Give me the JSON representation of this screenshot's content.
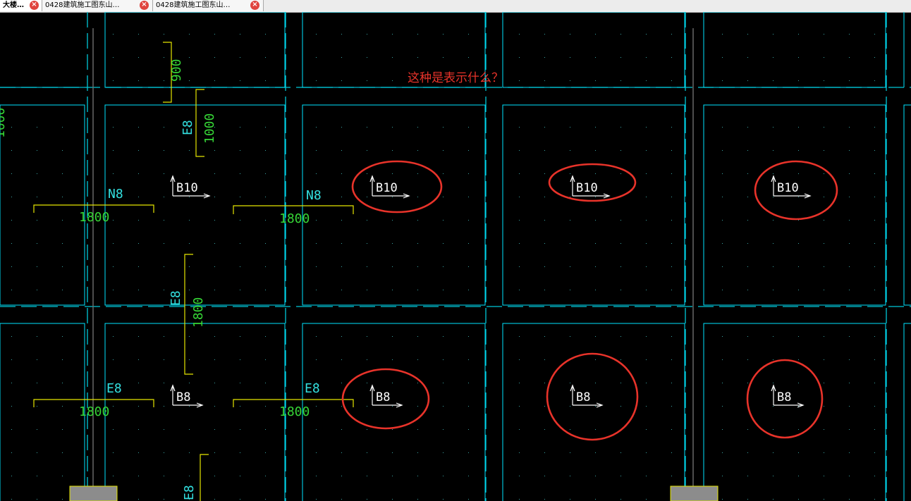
{
  "tabs": [
    {
      "label": "大楼…",
      "close_icon": "close-icon"
    },
    {
      "label": "0428建筑施工图东山…",
      "close_icon": "close-icon"
    },
    {
      "label": "0428建筑施工图东山…",
      "close_icon": "close-icon"
    }
  ],
  "annotation": {
    "question": "这种是表示什么？"
  },
  "labels": {
    "dim_900": "900",
    "dim_1000": "1000",
    "dim_1800": "1800",
    "rebar_e8": "E8",
    "rebar_n8": "N8",
    "bottom_b10": "B10",
    "bottom_b8": "B8"
  },
  "colors": {
    "background": "#000000",
    "grid_axis": "#00c8d8",
    "beam_line": "#00e5ff",
    "dimension_bracket": "#e6e600",
    "dimension_text": "#36d636",
    "rebar_text": "#33e0e0",
    "annotation": "#e8332a",
    "symbol": "#ffffff",
    "hatch_block": "#8c8c8c"
  }
}
